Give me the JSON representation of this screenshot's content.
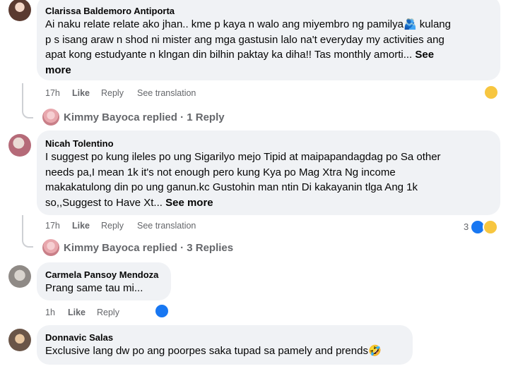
{
  "comments": [
    {
      "author": "Clarissa Baldemoro Antiporta",
      "text_lines": [
        "Ai naku relate relate ako jhan.. kme p kaya n walo ang miyembro ng pamilya",
        "p s isang araw n shod ni mister ang mga gastusin lalo na't everyday my activities ang",
        "apat kong estudyante n klngan din bilhin paktay ka diha!! Tas monthly amorti..."
      ],
      "text_line1_tail": " kulang",
      "see_more": "See",
      "see_more_2": "more",
      "time": "17h",
      "like": "Like",
      "reply": "Reply",
      "see_translation": "See translation"
    },
    {
      "replier": "Kimmy Bayoca",
      "replied_text": "replied · 1 Reply"
    },
    {
      "author": "Nicah Tolentino",
      "text_lines": [
        "I suggest po kung ileles po ung Sigarilyo mejo Tipid at maipapandagdag po Sa other",
        "needs pa,I mean 1k it's not enough pero kung Kya po Mag Xtra Ng income",
        "makakatulong din po ung ganun.kc Gustohin man ntin Di kakayanin tlga Ang 1k",
        "so,,Suggest to Have Xt..."
      ],
      "see_more": "See more",
      "time": "17h",
      "like": "Like",
      "reply": "Reply",
      "see_translation": "See translation",
      "reaction_count": "3"
    },
    {
      "replier": "Kimmy Bayoca",
      "replied_text": "replied · 3 Replies"
    },
    {
      "author": "Carmela Pansoy Mendoza",
      "text": "Prang same tau mi...",
      "time": "1h",
      "like": "Like",
      "reply": "Reply"
    },
    {
      "author": "Donnavic Salas",
      "text": "Exclusive lang dw po ang poorpes saka tupad sa pamely and prends"
    }
  ],
  "colors": {
    "bubble": "#f0f2f5",
    "meta": "#65676b",
    "like_blue": "#1877f2"
  }
}
